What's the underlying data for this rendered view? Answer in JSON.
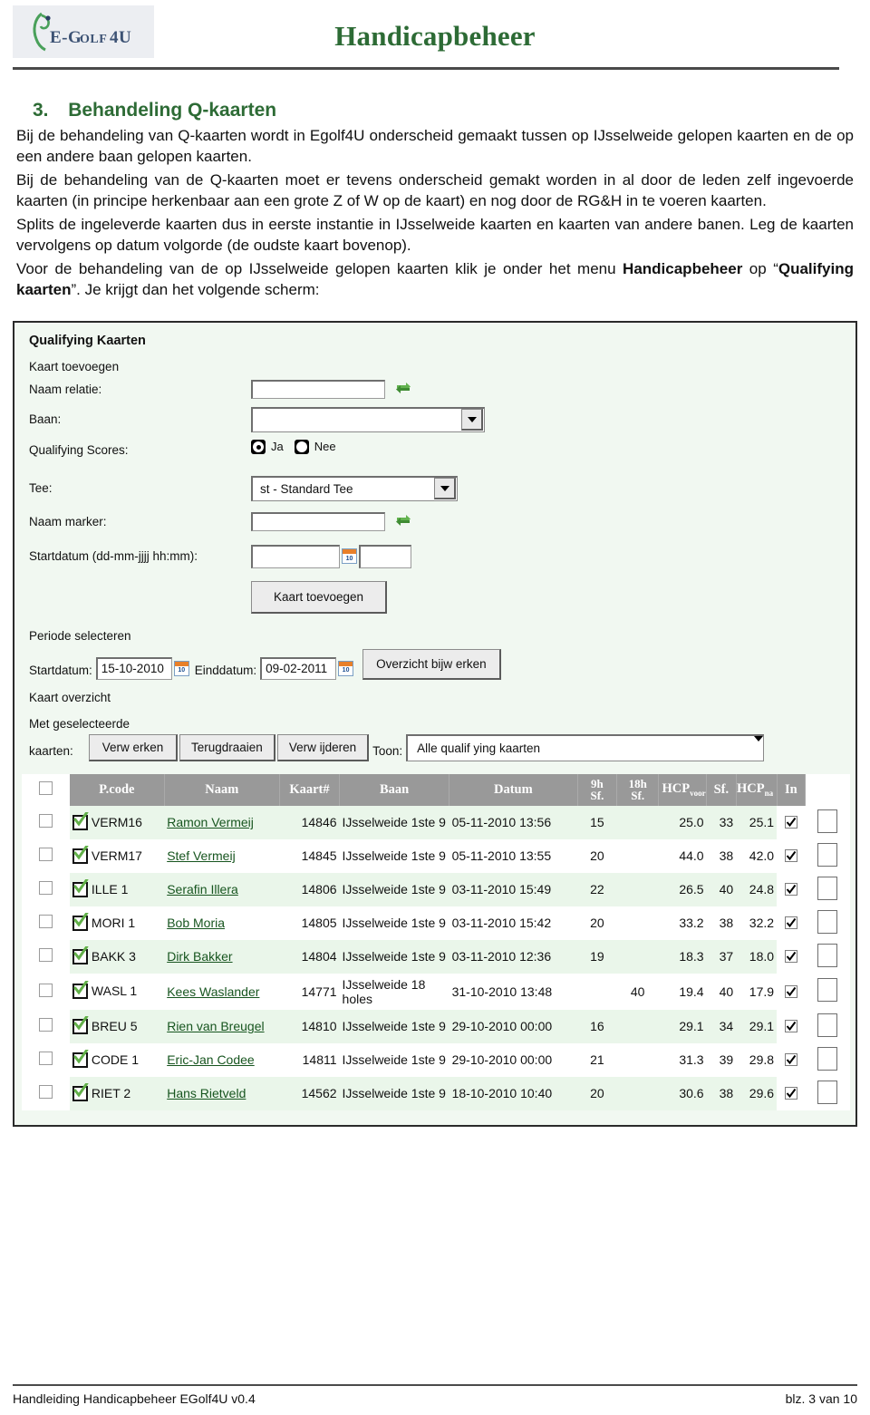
{
  "header": {
    "logo_alt": "E-GOLF4U",
    "logo_text": "E-GOLF4U",
    "title": "Handicapbeheer"
  },
  "document": {
    "section_number": "3.",
    "section_title": "Behandeling Q-kaarten",
    "paragraphs": [
      "Bij de behandeling van Q-kaarten wordt in Egolf4U onderscheid gemaakt tussen op IJsselweide gelopen kaarten en de op een andere baan gelopen kaarten.",
      "Bij de behandeling van de Q-kaarten moet er tevens onderscheid gemakt worden in al door de leden zelf ingevoerde kaarten (in principe herkenbaar aan een grote Z of W op de kaart) en nog door de RG&H in te voeren kaarten.",
      "Splits de ingeleverde kaarten dus in eerste instantie in IJsselweide kaarten en kaarten van andere banen. Leg de kaarten vervolgens op datum volgorde (de oudste kaart bovenop)."
    ],
    "final_paragraph": {
      "part1": "Voor de behandeling van de op IJsselweide gelopen kaarten klik je onder het menu ",
      "bold1": "Handicapbeheer",
      "part2": " op “",
      "bold2": "Qualifying kaarten",
      "part3": "”. Je krijgt dan het volgende scherm:"
    }
  },
  "screenshot": {
    "panel_title": "Qualifying Kaarten",
    "add_card_strip": "Kaart toevoegen",
    "form": {
      "naam_relatie_label": "Naam relatie:",
      "naam_relatie_value": "",
      "baan_label": "Baan:",
      "baan_value": "",
      "qualifying_scores_label": "Qualifying Scores:",
      "radio_ja": "Ja",
      "radio_nee": "Nee",
      "radio_selected": "Ja",
      "tee_label": "Tee:",
      "tee_value": "st - Standard Tee",
      "naam_marker_label": "Naam marker:",
      "naam_marker_value": "",
      "startdatum_label": "Startdatum (dd-mm-jjjj hh:mm):",
      "startdatum_value": "",
      "starttijd_value": "",
      "add_button": "Kaart toevoegen"
    },
    "period": {
      "strip_label": "Periode selecteren",
      "startdatum_label": "Startdatum:",
      "startdatum_value": "15-10-2010",
      "einddatum_label": "Einddatum:",
      "einddatum_value": "09-02-2011",
      "refresh_button": "Overzicht bijw erken"
    },
    "overview": {
      "strip_label": "Kaart overzicht",
      "with_selected_label_line1": "Met geselecteerde",
      "with_selected_label_line2": "kaarten:",
      "buttons": [
        "Verw erken",
        "Terugdraaien",
        "Verw ijderen"
      ],
      "toon_label": "Toon:",
      "toon_value": "Alle qualif ying kaarten"
    },
    "table": {
      "columns": [
        {
          "key": "select",
          "label": ""
        },
        {
          "key": "pcode",
          "label": "P.code"
        },
        {
          "key": "naam",
          "label": "Naam"
        },
        {
          "key": "kaart",
          "label": "Kaart#"
        },
        {
          "key": "baan",
          "label": "Baan"
        },
        {
          "key": "datum",
          "label": "Datum"
        },
        {
          "key": "h9",
          "label": "9h Sf."
        },
        {
          "key": "h18",
          "label": "18h Sf."
        },
        {
          "key": "hcpvoor",
          "label": "HCP voor"
        },
        {
          "key": "sf",
          "label": "Sf."
        },
        {
          "key": "hcpna",
          "label": "HCP na"
        },
        {
          "key": "in",
          "label": "In"
        },
        {
          "key": "doc",
          "label": ""
        }
      ],
      "rows": [
        {
          "pcode": "VERM16",
          "naam": "Ramon Vermeij",
          "kaart": "14846",
          "baan": "IJsselweide 1ste 9",
          "datum": "05-11-2010 13:56",
          "h9": "15",
          "h18": "",
          "hcpvoor": "25.0",
          "sf": "33",
          "hcpna": "25.1",
          "in": true
        },
        {
          "pcode": "VERM17",
          "naam": "Stef Vermeij",
          "kaart": "14845",
          "baan": "IJsselweide 1ste 9",
          "datum": "05-11-2010 13:55",
          "h9": "20",
          "h18": "",
          "hcpvoor": "44.0",
          "sf": "38",
          "hcpna": "42.0",
          "in": true
        },
        {
          "pcode": "ILLE 1",
          "naam": "Serafin Illera",
          "kaart": "14806",
          "baan": "IJsselweide 1ste 9",
          "datum": "03-11-2010 15:49",
          "h9": "22",
          "h18": "",
          "hcpvoor": "26.5",
          "sf": "40",
          "hcpna": "24.8",
          "in": true
        },
        {
          "pcode": "MORI 1",
          "naam": "Bob Moria",
          "kaart": "14805",
          "baan": "IJsselweide 1ste 9",
          "datum": "03-11-2010 15:42",
          "h9": "20",
          "h18": "",
          "hcpvoor": "33.2",
          "sf": "38",
          "hcpna": "32.2",
          "in": true
        },
        {
          "pcode": "BAKK 3",
          "naam": "Dirk Bakker",
          "kaart": "14804",
          "baan": "IJsselweide 1ste 9",
          "datum": "03-11-2010 12:36",
          "h9": "19",
          "h18": "",
          "hcpvoor": "18.3",
          "sf": "37",
          "hcpna": "18.0",
          "in": true
        },
        {
          "pcode": "WASL 1",
          "naam": "Kees Waslander",
          "kaart": "14771",
          "baan": "IJsselweide 18 holes",
          "datum": "31-10-2010 13:48",
          "h9": "",
          "h18": "40",
          "hcpvoor": "19.4",
          "sf": "40",
          "hcpna": "17.9",
          "in": true
        },
        {
          "pcode": "BREU 5",
          "naam": "Rien van Breugel",
          "kaart": "14810",
          "baan": "IJsselweide 1ste 9",
          "datum": "29-10-2010 00:00",
          "h9": "16",
          "h18": "",
          "hcpvoor": "29.1",
          "sf": "34",
          "hcpna": "29.1",
          "in": true
        },
        {
          "pcode": "CODE 1",
          "naam": "Eric-Jan Codee",
          "kaart": "14811",
          "baan": "IJsselweide 1ste 9",
          "datum": "29-10-2010 00:00",
          "h9": "21",
          "h18": "",
          "hcpvoor": "31.3",
          "sf": "39",
          "hcpna": "29.8",
          "in": true
        },
        {
          "pcode": "RIET 2",
          "naam": "Hans Rietveld",
          "kaart": "14562",
          "baan": "IJsselweide 1ste 9",
          "datum": "18-10-2010 10:40",
          "h9": "20",
          "h18": "",
          "hcpvoor": "30.6",
          "sf": "38",
          "hcpna": "29.6",
          "in": true
        }
      ]
    }
  },
  "footer": {
    "left": "Handleiding Handicapbeheer EGolf4U v0.4",
    "right": "blz. 3 van 10"
  },
  "colors": {
    "heading_green": "#2d6b35",
    "panel_bg": "#f1f8f1",
    "table_header_bg": "#999999",
    "row_alt_bg": "#eaf6ea",
    "link_green": "#17551f"
  }
}
